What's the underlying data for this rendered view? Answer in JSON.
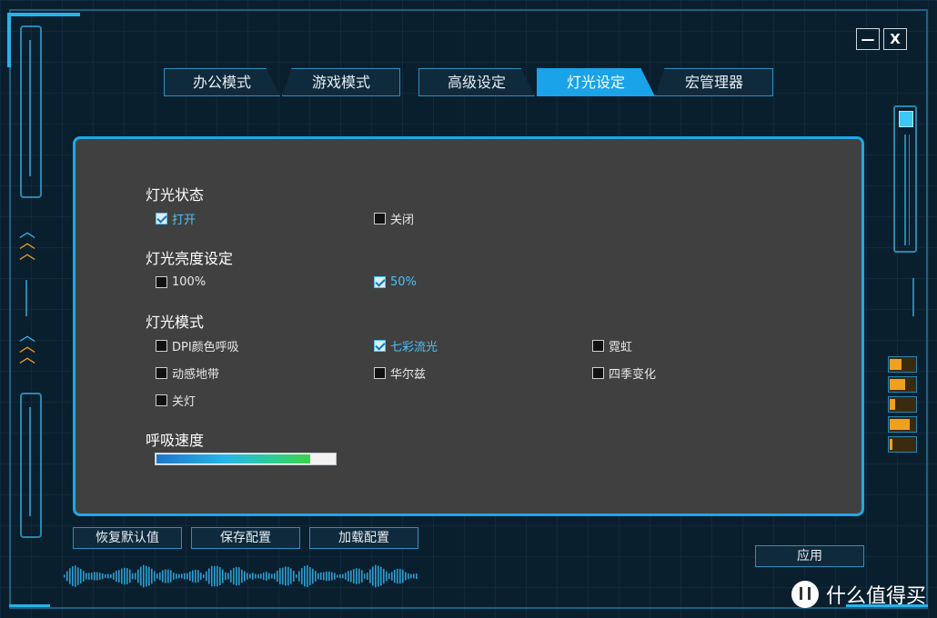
{
  "window": {
    "minimize_label": "—",
    "close_label": "X"
  },
  "tabs": [
    {
      "label": "办公模式",
      "active": false
    },
    {
      "label": "游戏模式",
      "active": false
    },
    {
      "label": "高级设定",
      "active": false
    },
    {
      "label": "灯光设定",
      "active": true
    },
    {
      "label": "宏管理器",
      "active": false
    }
  ],
  "panel": {
    "light_state": {
      "title": "灯光状态",
      "options": [
        {
          "label": "打开",
          "checked": true
        },
        {
          "label": "关闭",
          "checked": false
        }
      ]
    },
    "brightness": {
      "title": "灯光亮度设定",
      "options": [
        {
          "label": "100%",
          "checked": false
        },
        {
          "label": "50%",
          "checked": true
        }
      ]
    },
    "mode": {
      "title": "灯光模式",
      "options": [
        {
          "label": "DPI颜色呼吸",
          "checked": false
        },
        {
          "label": "七彩流光",
          "checked": true
        },
        {
          "label": "霓虹",
          "checked": false
        },
        {
          "label": "动感地带",
          "checked": false
        },
        {
          "label": "华尔兹",
          "checked": false
        },
        {
          "label": "四季变化",
          "checked": false
        },
        {
          "label": "关灯",
          "checked": false
        }
      ]
    },
    "breath_speed": {
      "title": "呼吸速度",
      "value_percent": 86
    }
  },
  "buttons": {
    "restore_default": "恢复默认值",
    "save_config": "保存配置",
    "load_config": "加载配置",
    "apply": "应用"
  },
  "side_levels": [
    0.45,
    0.6,
    0.2,
    0.8,
    0.1
  ],
  "colors": {
    "accent": "#1aa3e8",
    "panel_bg": "#404040",
    "app_bg": "#0a1f2e",
    "level_fill": "#f0a020"
  },
  "watermark": {
    "text": "什么值得买"
  }
}
